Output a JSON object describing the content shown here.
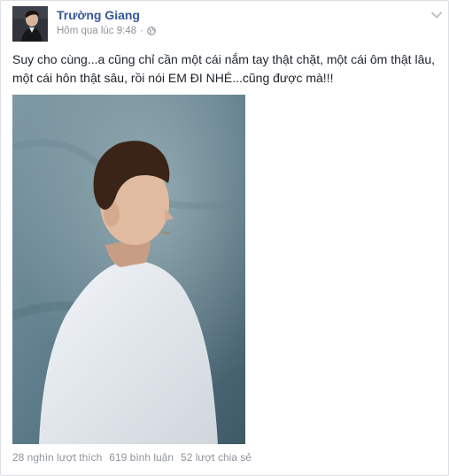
{
  "post": {
    "author": "Trường Giang",
    "timestamp": "Hôm qua lúc 9:48",
    "separator": "·",
    "privacy_icon": "globe-icon",
    "menu_icon": "chevron-down-icon",
    "text": "Suy cho cùng...a cũng chỉ cần một cái nắm tay thật chặt, một cái ôm thật lâu, một cái hôn thật sâu, rồi nói EM ĐI NHÉ...cũng được mà!!!"
  },
  "stats": {
    "likes": "28 nghìn lượt thích",
    "comments": "619 bình luận",
    "shares": "52 lượt chia sẻ"
  },
  "colors": {
    "author_link": "#365899",
    "meta_text": "#90949c",
    "body_text": "#1d2129",
    "border": "#dddfe2"
  }
}
